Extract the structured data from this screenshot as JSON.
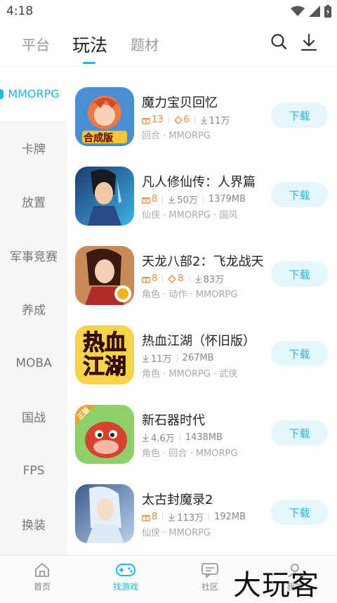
{
  "status": {
    "time": "4:18"
  },
  "topnav": {
    "tabs": [
      {
        "label": "平台",
        "active": false
      },
      {
        "label": "玩法",
        "active": true
      },
      {
        "label": "题材",
        "active": false
      }
    ]
  },
  "sidebar": {
    "items": [
      {
        "label": "MMORPG",
        "active": true
      },
      {
        "label": "卡牌"
      },
      {
        "label": "放置"
      },
      {
        "label": "军事竞赛"
      },
      {
        "label": "养成"
      },
      {
        "label": "MOBA"
      },
      {
        "label": "国战"
      },
      {
        "label": "FPS"
      },
      {
        "label": "换装"
      }
    ]
  },
  "games": [
    {
      "name": "魔力宝贝回忆",
      "gifts": "13",
      "coupons": "6",
      "downloads": "11万",
      "size": "",
      "tags": "回合 · MMORPG",
      "download_label": "下载",
      "cover_text": "合成版"
    },
    {
      "name": "凡人修仙传：人界篇",
      "gifts": "8",
      "coupons": "",
      "downloads": "50万",
      "size": "1379MB",
      "tags": "仙侠 · MMORPG · 国风",
      "download_label": "下载"
    },
    {
      "name": "天龙八部2：飞龙战天",
      "gifts": "8",
      "coupons": "8",
      "downloads": "83万",
      "size": "",
      "tags": "角色 · 动作 · MMORPG",
      "download_label": "下载"
    },
    {
      "name": "热血江湖（怀旧版）",
      "gifts": "",
      "coupons": "",
      "downloads": "11万",
      "size": "267MB",
      "tags": "角色 · MMORPG · 武侠",
      "download_label": "下载",
      "cover_text": "热血江湖"
    },
    {
      "name": "新石器时代",
      "gifts": "",
      "coupons": "",
      "downloads": "4.6万",
      "size": "1438MB",
      "tags": "角色 · 回合 · MMORPG",
      "download_label": "下载",
      "cover_text": "正版"
    },
    {
      "name": "太古封魔录2",
      "gifts": "8",
      "coupons": "",
      "downloads": "113万",
      "size": "192MB",
      "tags": "仙侠 · MMORPG",
      "download_label": "下载"
    }
  ],
  "bottomnav": {
    "items": [
      {
        "label": "首页",
        "active": false
      },
      {
        "label": "找游戏",
        "active": true
      },
      {
        "label": "社区",
        "active": false
      },
      {
        "label": "我的",
        "active": false
      }
    ]
  },
  "watermark": "大玩客",
  "colors": {
    "accent": "#1fb6ea",
    "gift": "#f08a3c"
  }
}
